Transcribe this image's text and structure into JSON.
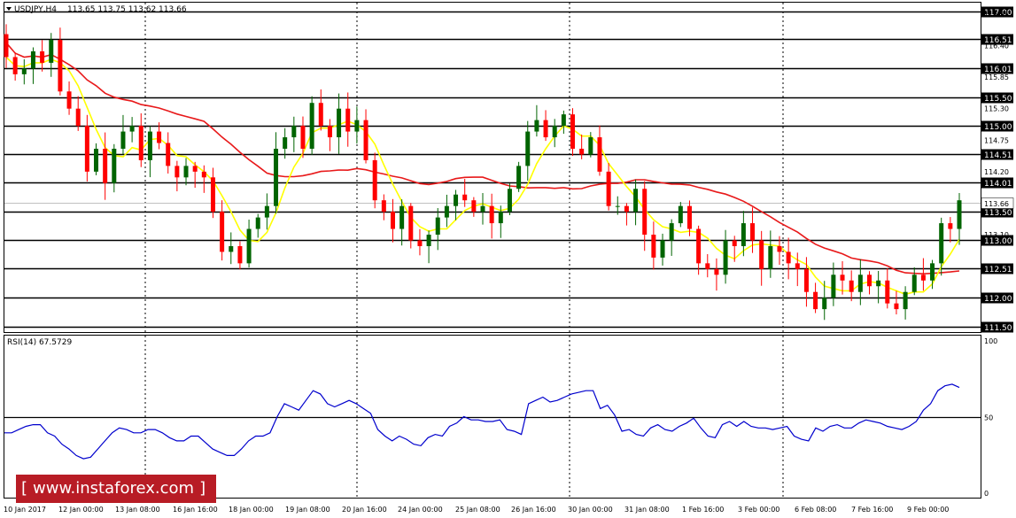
{
  "header": {
    "symbol": "USDJPY,H4",
    "ohlc": "113.65 113.75 113.62 113.66"
  },
  "rsi_header": "RSI(14) 67.5729",
  "logo": {
    "left": "[",
    "text": "www.instaforex.com",
    "right": "]"
  },
  "colors": {
    "bull_body": "#006400",
    "bear_body": "#ff0000",
    "ma_slow": "#e8191a",
    "ma_fast": "#ffff00",
    "rsi_line": "#0000cd",
    "tag_bg": "#000000"
  },
  "chart_data": [
    {
      "type": "candlestick",
      "symbol": "USDJPY",
      "timeframe": "H4",
      "ylim": [
        111.4,
        117.15
      ],
      "tick_labels": [
        "116.95",
        "116.40",
        "115.85",
        "115.30",
        "114.75",
        "114.20",
        "113.10"
      ],
      "levels": [
        117.0,
        116.51,
        116.01,
        115.5,
        115.0,
        114.51,
        114.01,
        113.5,
        113.0,
        112.51,
        112.0,
        111.5
      ],
      "level_labels": [
        "117.00",
        "116.51",
        "116.01",
        "115.50",
        "115.00",
        "114.51",
        "114.01",
        "113.50",
        "113.00",
        "112.51",
        "112.00",
        "111.50"
      ],
      "current_price": 113.66,
      "current_price_label": "113.66",
      "x_labels": [
        "10 Jan 2017",
        "12 Jan 00:00",
        "13 Jan 08:00",
        "16 Jan 16:00",
        "18 Jan 00:00",
        "19 Jan 08:00",
        "20 Jan 16:00",
        "24 Jan 00:00",
        "25 Jan 08:00",
        "26 Jan 16:00",
        "30 Jan 00:00",
        "31 Jan 08:00",
        "1 Feb 16:00",
        "3 Feb 00:00",
        "6 Feb 08:00",
        "7 Feb 16:00",
        "9 Feb 00:00"
      ],
      "separators": [
        "13 Jan",
        "20 Jan",
        "27 Jan",
        "3 Feb"
      ],
      "close_path": [
        116.2,
        115.9,
        116.0,
        116.3,
        116.1,
        116.5,
        115.6,
        115.3,
        115.0,
        114.2,
        114.6,
        114.0,
        114.6,
        114.9,
        115.0,
        114.4,
        114.9,
        114.7,
        114.3,
        114.1,
        114.3,
        114.2,
        114.1,
        113.5,
        112.8,
        112.9,
        112.6,
        113.2,
        113.4,
        113.6,
        114.6,
        114.8,
        115.0,
        114.6,
        115.4,
        115.0,
        114.8,
        115.3,
        114.9,
        115.1,
        114.4,
        113.7,
        113.5,
        113.2,
        113.6,
        113.0,
        112.9,
        113.1,
        113.4,
        113.6,
        113.8,
        113.7,
        113.5,
        113.6,
        113.3,
        113.5,
        113.9,
        114.3,
        114.9,
        115.1,
        114.8,
        115.0,
        115.2,
        114.6,
        114.5,
        114.8,
        114.2,
        113.6,
        113.6,
        113.5,
        113.9,
        113.1,
        112.7,
        113.0,
        113.3,
        113.6,
        113.2,
        112.6,
        112.5,
        112.4,
        113.0,
        112.9,
        113.3,
        113.0,
        112.5,
        112.9,
        112.8,
        112.6,
        112.5,
        112.1,
        111.8,
        112.0,
        112.4,
        112.3,
        112.1,
        112.4,
        112.2,
        112.3,
        111.9,
        111.8,
        112.1,
        112.4,
        112.3,
        112.6,
        113.3,
        113.2,
        113.7
      ],
      "current_level_label_note": "113.66",
      "series": [
        {
          "name": "MA slow"
        },
        {
          "name": "MA fast"
        }
      ]
    },
    {
      "type": "line",
      "name": "RSI(14)",
      "last_value": 67.5729,
      "ylim": [
        0,
        100
      ],
      "levels": [
        50
      ],
      "tick_labels": [
        "100",
        "50",
        "0"
      ],
      "values": [
        40,
        40,
        42,
        44,
        45,
        45,
        40,
        38,
        33,
        30,
        26,
        24,
        25,
        30,
        35,
        40,
        43,
        42,
        40,
        40,
        42,
        42,
        40,
        37,
        35,
        35,
        38,
        38,
        34,
        30,
        28,
        26,
        26,
        30,
        35,
        38,
        38,
        40,
        50,
        58,
        56,
        54,
        60,
        66,
        64,
        58,
        56,
        58,
        60,
        58,
        55,
        52,
        42,
        38,
        35,
        38,
        36,
        33,
        32,
        37,
        39,
        38,
        44,
        46,
        50,
        48,
        48,
        47,
        47,
        48,
        42,
        41,
        39,
        58,
        60,
        62,
        59,
        60,
        62,
        64,
        65,
        66,
        66,
        55,
        57,
        51,
        41,
        42,
        39,
        38,
        43,
        45,
        42,
        41,
        44,
        46,
        49,
        43,
        38,
        37,
        45,
        47,
        44,
        47,
        44,
        43,
        43,
        42,
        43,
        44,
        38,
        36,
        35,
        43,
        41,
        44,
        45,
        43,
        43,
        46,
        48,
        47,
        46,
        44,
        43,
        42,
        44,
        47,
        54,
        58,
        66,
        69,
        70,
        68
      ]
    }
  ]
}
